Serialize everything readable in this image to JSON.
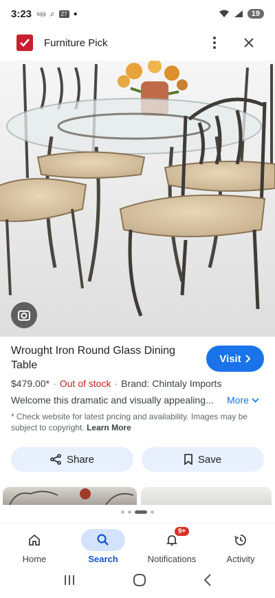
{
  "status_bar": {
    "time": "3:23",
    "mini_app": "kijiji",
    "calendar_day": "27",
    "battery": "19"
  },
  "header": {
    "site_name": "Furniture Pick"
  },
  "product": {
    "title": "Wrought Iron Round Glass Dining Table",
    "visit_label": "Visit",
    "price": "$479.00*",
    "stock_status": "Out of stock",
    "brand": "Brand: Chintaly Imports",
    "description": "Welcome this dramatic and visually appealing...",
    "more_label": "More",
    "disclaimer": "* Check website for latest pricing and availability. Images may be subject to copyright.",
    "learn_more": "Learn More"
  },
  "actions": {
    "share_label": "Share",
    "save_label": "Save"
  },
  "bottom_nav": {
    "items": [
      {
        "label": "Home"
      },
      {
        "label": "Search"
      },
      {
        "label": "Notifications",
        "badge": "9+"
      },
      {
        "label": "Activity"
      }
    ]
  },
  "colors": {
    "accent": "#1a73e8",
    "out_of_stock": "#c5221f",
    "logo": "#c8202f",
    "chip_bg": "#e8f0fe"
  }
}
